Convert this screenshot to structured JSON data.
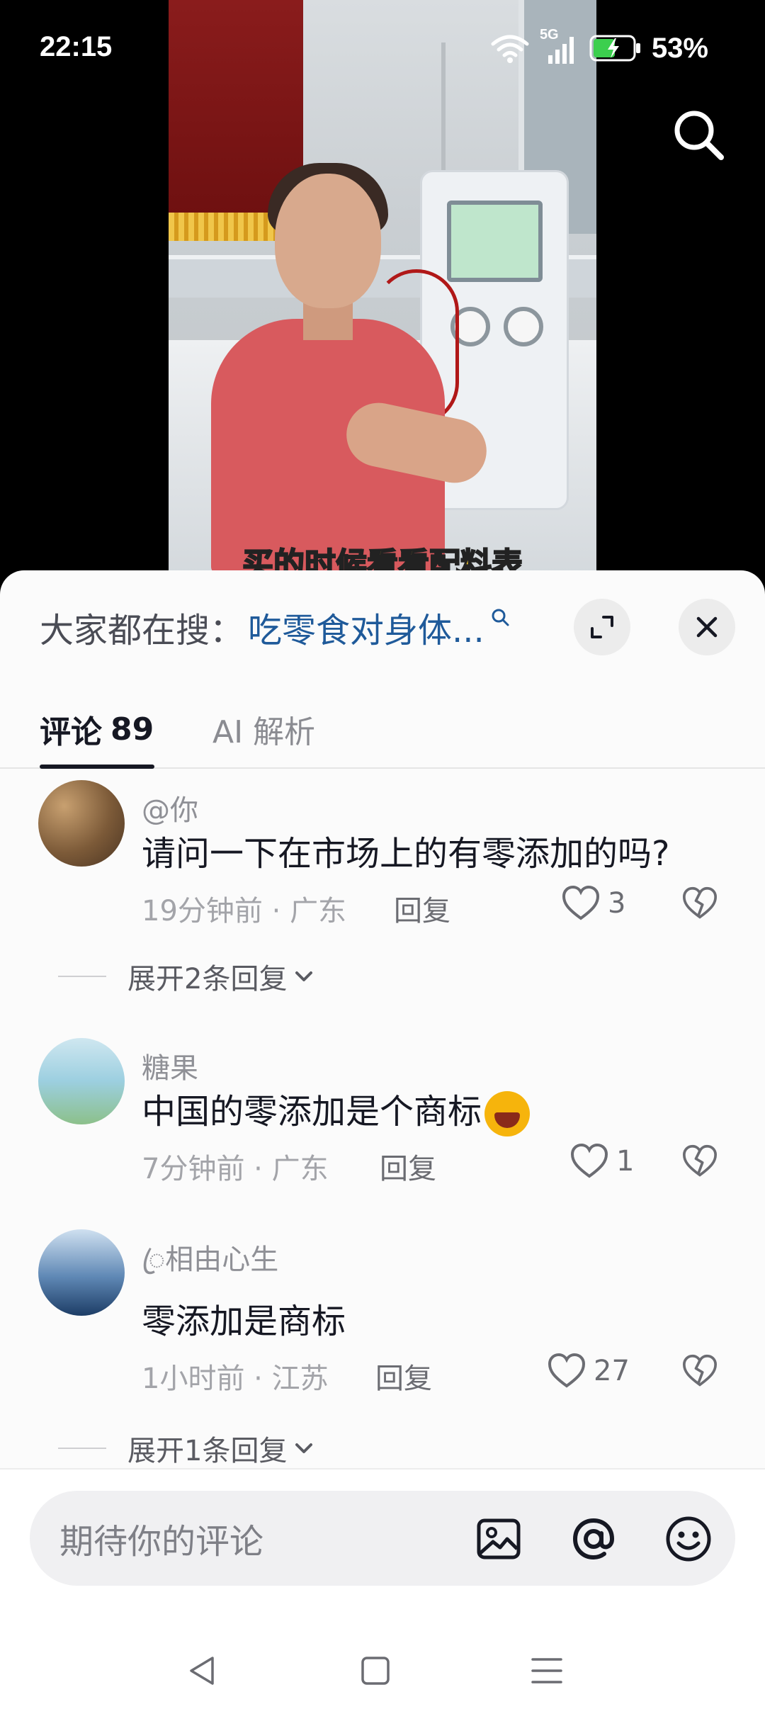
{
  "status_bar": {
    "time": "22:15",
    "network": "5G",
    "battery_percent": "53%"
  },
  "video": {
    "subtitle": "买的时候看看配料表"
  },
  "hot_search": {
    "prefix": "大家都在搜：",
    "query": "吃零食对身体..."
  },
  "tabs": {
    "comments_label": "评论",
    "comments_count": "89",
    "ai_label": "AI 解析"
  },
  "comments": [
    {
      "user": "@你",
      "text": "请问一下在市场上的有零添加的吗?",
      "time": "19分钟前",
      "location": "广东",
      "reply_label": "回复",
      "likes": "3",
      "expand_label": "展开2条回复"
    },
    {
      "user": "糖果",
      "text": "中国的零添加是个商标",
      "emoji": "grinning-squint-emoji",
      "time": "7分钟前",
      "location": "广东",
      "reply_label": "回复",
      "likes": "1"
    },
    {
      "user": "◌ꦿ相由心生",
      "text": "零添加是商标",
      "time": "1小时前",
      "location": "江苏",
      "reply_label": "回复",
      "likes": "27",
      "expand_label": "展开1条回复"
    }
  ],
  "input": {
    "placeholder": "期待你的评论"
  },
  "icons": {
    "search": "search-icon",
    "expand": "expand-icon",
    "close": "close-icon",
    "image": "image-icon",
    "mention": "at-icon",
    "emoji": "emoji-icon",
    "like": "heart-icon",
    "dislike": "broken-heart-icon",
    "nav_back": "back-triangle-icon",
    "nav_home": "home-square-icon",
    "nav_menu": "menu-lines-icon"
  },
  "colors": {
    "accent_link": "#1f5a9a",
    "text_primary": "#161823",
    "text_secondary": "#a3a4a9",
    "subtitle": "#ffd230"
  }
}
